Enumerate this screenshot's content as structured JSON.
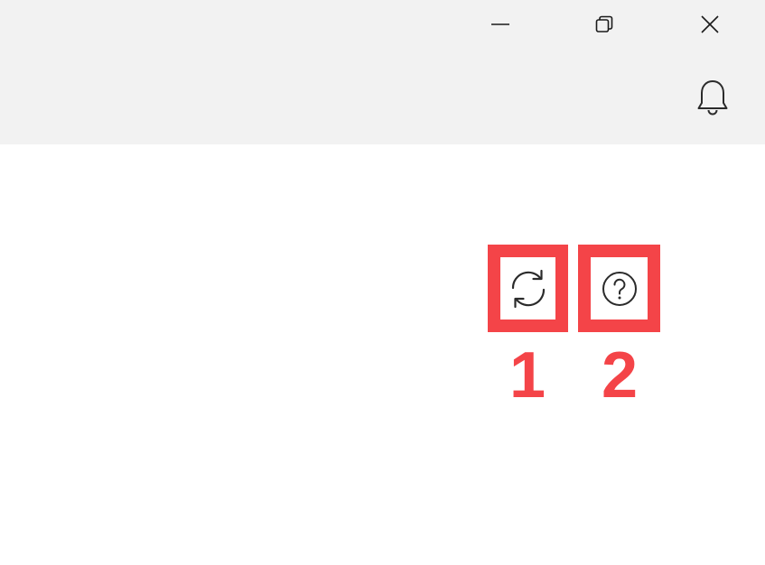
{
  "window_controls": {
    "minimize_icon": "minimize-icon",
    "restore_icon": "restore-icon",
    "close_icon": "close-icon"
  },
  "header": {
    "notifications_icon": "bell-icon"
  },
  "toolbar": {
    "refresh_icon": "refresh-icon",
    "help_icon": "help-circle-icon"
  },
  "annotations": {
    "label_1": "1",
    "label_2": "2",
    "highlight_color": "#f44448"
  }
}
